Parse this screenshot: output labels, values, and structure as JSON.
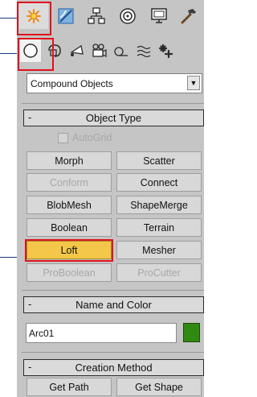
{
  "dropdown": {
    "value": "Compound Objects"
  },
  "object_type": {
    "title": "Object Type",
    "collapse_symbol": "-",
    "autogrid_label": "AutoGrid",
    "buttons": [
      {
        "label": "Morph",
        "state": "normal"
      },
      {
        "label": "Scatter",
        "state": "normal"
      },
      {
        "label": "Conform",
        "state": "disabled"
      },
      {
        "label": "Connect",
        "state": "normal"
      },
      {
        "label": "BlobMesh",
        "state": "normal"
      },
      {
        "label": "ShapeMerge",
        "state": "normal"
      },
      {
        "label": "Boolean",
        "state": "normal"
      },
      {
        "label": "Terrain",
        "state": "normal"
      },
      {
        "label": "Loft",
        "state": "selected"
      },
      {
        "label": "Mesher",
        "state": "normal"
      },
      {
        "label": "ProBoolean",
        "state": "disabled"
      },
      {
        "label": "ProCutter",
        "state": "disabled"
      }
    ]
  },
  "name_color": {
    "title": "Name and Color",
    "collapse_symbol": "-",
    "name_value": "Arc01",
    "swatch_color": "#2f8a11"
  },
  "creation_method": {
    "title": "Creation Method",
    "collapse_symbol": "-",
    "buttons": [
      {
        "label": "Get Path"
      },
      {
        "label": "Get Shape"
      }
    ]
  },
  "colors": {
    "highlight": "#e0121c",
    "selected_button": "#f4c74a",
    "panel_bg": "#c5c5c5"
  },
  "icons": {
    "command_tabs": [
      "create-tab-sun-icon",
      "modify-tab-icon",
      "hierarchy-tab-icon",
      "motion-tab-icon",
      "display-tab-icon",
      "utilities-hammer-icon"
    ],
    "create_categories": [
      "geometry-sphere-icon",
      "shapes-icon",
      "lights-icon",
      "cameras-icon",
      "helpers-icon",
      "space-warps-icon",
      "systems-icon"
    ]
  }
}
